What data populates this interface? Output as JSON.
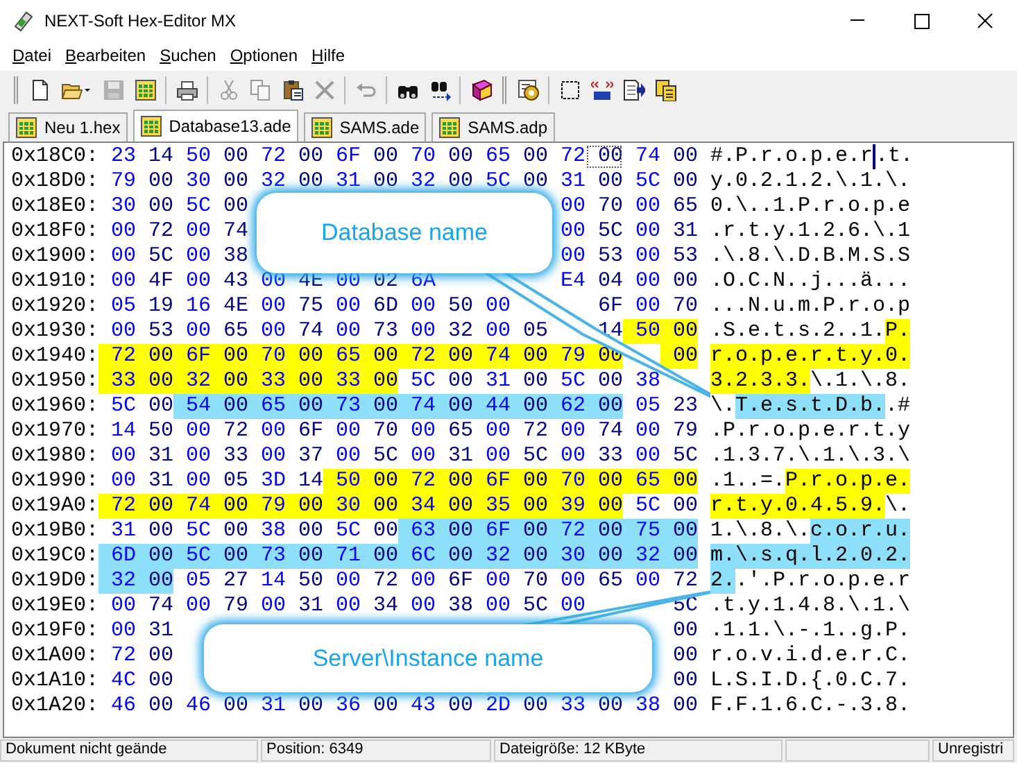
{
  "window": {
    "title": "NEXT-Soft Hex-Editor MX"
  },
  "menu": [
    {
      "label": "Datei"
    },
    {
      "label": "Bearbeiten"
    },
    {
      "label": "Suchen"
    },
    {
      "label": "Optionen"
    },
    {
      "label": "Hilfe"
    }
  ],
  "toolbar": [
    {
      "kind": "grip"
    },
    {
      "kind": "new",
      "disabled": false
    },
    {
      "kind": "open",
      "disabled": false
    },
    {
      "kind": "save",
      "disabled": true
    },
    {
      "kind": "hexfile",
      "disabled": false
    },
    {
      "kind": "separator"
    },
    {
      "kind": "print",
      "disabled": false
    },
    {
      "kind": "separator"
    },
    {
      "kind": "cut",
      "disabled": true
    },
    {
      "kind": "copy",
      "disabled": true
    },
    {
      "kind": "paste",
      "disabled": false
    },
    {
      "kind": "delete",
      "disabled": true
    },
    {
      "kind": "separator"
    },
    {
      "kind": "undo",
      "disabled": true
    },
    {
      "kind": "separator"
    },
    {
      "kind": "find",
      "disabled": false
    },
    {
      "kind": "findnext",
      "disabled": false
    },
    {
      "kind": "separator"
    },
    {
      "kind": "book",
      "disabled": false
    },
    {
      "kind": "grip"
    },
    {
      "kind": "tool",
      "disabled": false
    },
    {
      "kind": "separator"
    },
    {
      "kind": "select",
      "disabled": false
    },
    {
      "kind": "convert",
      "disabled": false
    },
    {
      "kind": "export",
      "disabled": false
    },
    {
      "kind": "pages",
      "disabled": false
    }
  ],
  "tabs": [
    {
      "label": "Neu 1.hex",
      "selected": false
    },
    {
      "label": "Database13.ade",
      "selected": true
    },
    {
      "label": "SAMS.ade",
      "selected": false
    },
    {
      "label": "SAMS.adp",
      "selected": false
    }
  ],
  "hex_rows": [
    {
      "address": "0x18C0:",
      "bytes": [
        {
          "values": [
            "23",
            "14",
            "50",
            "00",
            "72",
            "00",
            "6F",
            "00",
            "70",
            "00",
            "65",
            "00",
            "72"
          ]
        },
        {
          "values": [
            "00"
          ],
          "cursor": true
        },
        {
          "values": [
            "74",
            "00"
          ]
        }
      ],
      "text": [
        {
          "chars": "#.P.r.o.p.e.r"
        },
        {
          "chars": ".",
          "cursor": true
        },
        {
          "chars": "t."
        }
      ]
    },
    {
      "address": "0x18D0:",
      "bytes": [
        {
          "values": [
            "79",
            "00",
            "30",
            "00",
            "32",
            "00",
            "31",
            "00",
            "32",
            "00",
            "5C",
            "00",
            "31",
            "00",
            "5C",
            "00"
          ]
        }
      ],
      "text": [
        {
          "chars": "y.0.2.1.2.\\.1.\\."
        }
      ]
    },
    {
      "address": "0x18E0:",
      "bytes": [
        {
          "values": [
            "30",
            "00",
            "5C",
            "00"
          ]
        }
      ],
      "bytes_right": [
        {
          "values": [
            "00",
            "70",
            "00",
            "65"
          ]
        }
      ],
      "text": [
        {
          "chars": "0.\\..1.P.r.o.p.e"
        }
      ]
    },
    {
      "address": "0x18F0:",
      "bytes": [
        {
          "values": [
            "00",
            "72",
            "00",
            "74"
          ]
        }
      ],
      "bytes_right": [
        {
          "values": [
            "00",
            "5C",
            "00",
            "31"
          ]
        }
      ],
      "text": [
        {
          "chars": ".r.t.y.1.2.6.\\.1"
        }
      ]
    },
    {
      "address": "0x1900:",
      "bytes": [
        {
          "values": [
            "00",
            "5C",
            "00",
            "38"
          ]
        }
      ],
      "bytes_right": [
        {
          "values": [
            "00",
            "53",
            "00",
            "53"
          ]
        }
      ],
      "text": [
        {
          "chars": ".\\.8.\\.D.B.M.S.S"
        }
      ]
    },
    {
      "address": "0x1910:",
      "bytes": [
        {
          "values": [
            "00",
            "4F",
            "00",
            "43",
            "00",
            "4E",
            "00",
            "02",
            "6A"
          ]
        }
      ],
      "bytes_right": [
        {
          "values": [
            "E4",
            "04",
            "00",
            "00"
          ]
        }
      ],
      "text": [
        {
          "chars": ".O.C.N..j...ä..."
        }
      ]
    },
    {
      "address": "0x1920:",
      "bytes": [
        {
          "values": [
            "05",
            "19",
            "16",
            "4E",
            "00",
            "75",
            "00",
            "6D",
            "00",
            "50",
            "00"
          ]
        }
      ],
      "bytes_right": [
        {
          "values": [
            "6F",
            "00",
            "70"
          ]
        }
      ],
      "text": [
        {
          "chars": "...N.u.m.P.r.o.p"
        }
      ]
    },
    {
      "address": "0x1930:",
      "bytes": [
        {
          "values": [
            "00",
            "53",
            "00",
            "65",
            "00",
            "74",
            "00",
            "73",
            "00",
            "32",
            "00",
            "05"
          ]
        }
      ],
      "bytes_right": [
        {
          "values": [
            "14"
          ]
        },
        {
          "values": [
            "50",
            "00"
          ],
          "color": "#ffff00"
        }
      ],
      "text": [
        {
          "chars": ".S.e.t.s.2..1."
        },
        {
          "chars": "P.",
          "color": "#ffff00"
        }
      ]
    },
    {
      "address": "0x1940:",
      "bytes": [
        {
          "values": [
            "72",
            "00",
            "6F",
            "00",
            "70",
            "00",
            "65",
            "00",
            "72",
            "00",
            "74",
            "00",
            "79",
            "00"
          ],
          "color": "#ffff00"
        }
      ],
      "bytes_right": [
        {
          "values": [
            "00"
          ],
          "color": "#ffff00"
        }
      ],
      "text": [
        {
          "chars": "r.o.p.e.r.t.y.0.",
          "color": "#ffff00"
        }
      ]
    },
    {
      "address": "0x1950:",
      "bytes": [
        {
          "values": [
            "33",
            "00",
            "32",
            "00",
            "33",
            "00",
            "33",
            "00"
          ],
          "color": "#ffff00"
        },
        {
          "values": [
            "5C",
            "00",
            "31",
            "00",
            "5C",
            "00",
            "38"
          ]
        }
      ],
      "text": [
        {
          "chars": "3.2.3.3.",
          "color": "#ffff00"
        },
        {
          "chars": "\\.1.\\.8."
        }
      ]
    },
    {
      "address": "0x1960:",
      "bytes": [
        {
          "values": [
            "5C",
            "00"
          ]
        },
        {
          "values": [
            "54",
            "00",
            "65",
            "00",
            "73",
            "00",
            "74",
            "00",
            "44",
            "00",
            "62",
            "00"
          ],
          "color": "#8ee0fa"
        },
        {
          "values": [
            "05",
            "23"
          ]
        }
      ],
      "text": [
        {
          "chars": "\\."
        },
        {
          "chars": "T.e.s.t.D.b.",
          "color": "#8ee0fa"
        },
        {
          "chars": ".#"
        }
      ]
    },
    {
      "address": "0x1970:",
      "bytes": [
        {
          "values": [
            "14",
            "50",
            "00",
            "72",
            "00",
            "6F",
            "00",
            "70",
            "00",
            "65",
            "00",
            "72",
            "00",
            "74",
            "00",
            "79"
          ]
        }
      ],
      "text": [
        {
          "chars": ".P.r.o.p.e.r.t.y"
        }
      ]
    },
    {
      "address": "0x1980:",
      "bytes": [
        {
          "values": [
            "00",
            "31",
            "00",
            "33",
            "00",
            "37",
            "00",
            "5C",
            "00",
            "31",
            "00",
            "5C",
            "00",
            "33",
            "00",
            "5C"
          ]
        }
      ],
      "text": [
        {
          "chars": ".1.3.7.\\.1.\\.3.\\"
        }
      ]
    },
    {
      "address": "0x1990:",
      "bytes": [
        {
          "values": [
            "00",
            "31",
            "00",
            "05",
            "3D",
            "14"
          ]
        },
        {
          "values": [
            "50",
            "00",
            "72",
            "00",
            "6F",
            "00",
            "70",
            "00",
            "65",
            "00"
          ],
          "color": "#ffff00"
        }
      ],
      "text": [
        {
          "chars": ".1..=."
        },
        {
          "chars": "P.r.o.p.e.",
          "color": "#ffff00"
        }
      ]
    },
    {
      "address": "0x19A0:",
      "bytes": [
        {
          "values": [
            "72",
            "00",
            "74",
            "00",
            "79",
            "00",
            "30",
            "00",
            "34",
            "00",
            "35",
            "00",
            "39",
            "00"
          ],
          "color": "#ffff00"
        },
        {
          "values": [
            "5C",
            "00"
          ]
        }
      ],
      "text": [
        {
          "chars": "r.t.y.0.4.5.9.",
          "color": "#ffff00"
        },
        {
          "chars": "\\."
        }
      ]
    },
    {
      "address": "0x19B0:",
      "bytes": [
        {
          "values": [
            "31",
            "00",
            "5C",
            "00",
            "38",
            "00",
            "5C",
            "00"
          ]
        },
        {
          "values": [
            "63",
            "00",
            "6F",
            "00",
            "72",
            "00",
            "75",
            "00"
          ],
          "color": "#8ee0fa"
        }
      ],
      "text": [
        {
          "chars": "1.\\.8.\\."
        },
        {
          "chars": "c.o.r.u.",
          "color": "#8ee0fa"
        }
      ]
    },
    {
      "address": "0x19C0:",
      "bytes": [
        {
          "values": [
            "6D",
            "00",
            "5C",
            "00",
            "73",
            "00",
            "71",
            "00",
            "6C",
            "00",
            "32",
            "00",
            "30",
            "00",
            "32",
            "00"
          ],
          "color": "#8ee0fa"
        }
      ],
      "text": [
        {
          "chars": "m.\\.s.q.l.2.0.2.",
          "color": "#8ee0fa"
        }
      ]
    },
    {
      "address": "0x19D0:",
      "bytes": [
        {
          "values": [
            "32",
            "00"
          ],
          "color": "#8ee0fa"
        },
        {
          "values": [
            "05",
            "27",
            "14",
            "50",
            "00",
            "72",
            "00",
            "6F",
            "00",
            "70",
            "00",
            "65",
            "00",
            "72"
          ]
        }
      ],
      "text": [
        {
          "chars": "2.",
          "color": "#8ee0fa"
        },
        {
          "chars": ".'.P.r.o.p.e.r"
        }
      ]
    },
    {
      "address": "0x19E0:",
      "bytes": [
        {
          "values": [
            "00",
            "74",
            "00",
            "79",
            "00",
            "31",
            "00",
            "34",
            "00",
            "38",
            "00",
            "5C",
            "00"
          ]
        }
      ],
      "bytes_right": [
        {
          "values": [
            "5C"
          ]
        }
      ],
      "text": [
        {
          "chars": ".t.y.1.4.8.\\.1.\\"
        }
      ]
    },
    {
      "address": "0x19F0:",
      "bytes": [
        {
          "values": [
            "00",
            "31"
          ]
        }
      ],
      "bytes_right": [
        {
          "values": [
            "00"
          ]
        }
      ],
      "text": [
        {
          "chars": ".1.1.\\.-.1..g.P."
        }
      ]
    },
    {
      "address": "0x1A00:",
      "bytes": [
        {
          "values": [
            "72",
            "00"
          ]
        }
      ],
      "bytes_right": [
        {
          "values": [
            "00"
          ]
        }
      ],
      "text": [
        {
          "chars": "r.o.v.i.d.e.r.C."
        }
      ]
    },
    {
      "address": "0x1A10:",
      "bytes": [
        {
          "values": [
            "4C",
            "00"
          ]
        }
      ],
      "bytes_right": [
        {
          "values": [
            "00"
          ]
        }
      ],
      "text": [
        {
          "chars": "L.S.I.D.{.0.C.7."
        }
      ]
    },
    {
      "address": "0x1A20:",
      "bytes": [
        {
          "values": [
            "46",
            "00",
            "46",
            "00",
            "31",
            "00",
            "36",
            "00",
            "43",
            "00",
            "2D",
            "00",
            "33",
            "00",
            "38",
            "00"
          ]
        }
      ],
      "text": [
        {
          "chars": "F.F.1.6.C.-.3.8."
        }
      ]
    }
  ],
  "callouts": [
    {
      "text": "Database name"
    },
    {
      "text": "Server\\Instance name"
    }
  ],
  "status_bar": [
    {
      "text": "Dokument nicht geände"
    },
    {
      "text": "Position: 6349"
    },
    {
      "text": "Dateigröße: 12 KByte"
    },
    {
      "text": "Unregistri"
    }
  ]
}
